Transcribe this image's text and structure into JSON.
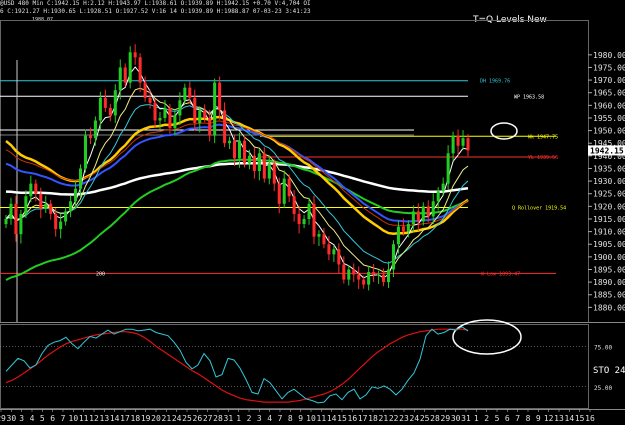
{
  "header": {
    "line1": "@USD  480 Min  C:1942.15  H:2.12  H:1943.97  L:1938.61  O:1939.89  H:1942.15  +0.70  V:4,704  OI",
    "line2": "6  C:1921.27  H:1930.65  L:1928.51  O:1927.52  V:16 14  O:1939.89  H:1988.87  07-03-23  3:41:23",
    "line3": "1988.07",
    "chart_title": "T=Q Levels New"
  },
  "chart_data": [
    {
      "type": "candlestick",
      "title": "T=Q Levels New",
      "ylim": [
        1875,
        1993
      ],
      "y_ticks": [
        "1980.00",
        "1975.00",
        "1970.00",
        "1965.00",
        "1960.00",
        "1955.00",
        "1950.00",
        "1945.00",
        "1940.00",
        "1935.00",
        "1930.00",
        "1925.00",
        "1920.00",
        "1915.00",
        "1910.00",
        "1905.00",
        "1900.00",
        "1895.00",
        "1890.00",
        "1885.00",
        "1880.00"
      ],
      "last_price_label": "1942.15",
      "x_ticks": [
        "29",
        "30",
        "3",
        "4",
        "5",
        "6",
        "7",
        "10",
        "11",
        "12",
        "13",
        "14",
        "17",
        "18",
        "19",
        "20",
        "21",
        "24",
        "25",
        "26",
        "27",
        "28",
        "31",
        "1",
        "2",
        "3",
        "4",
        "7",
        "8",
        "9",
        "10",
        "11",
        "14",
        "15",
        "16",
        "17",
        "18",
        "21",
        "22",
        "23",
        "24",
        "25",
        "28",
        "29",
        "30",
        "31",
        "1",
        "2",
        "5",
        "6",
        "7",
        "8",
        "9",
        "12",
        "13",
        "14",
        "15",
        "16"
      ],
      "levels": [
        {
          "label": "DH 1969.76",
          "value": 1969.76,
          "color": "#33c8d8"
        },
        {
          "label": "WP 1963.58",
          "value": 1963.58,
          "color": "#ffffff"
        },
        {
          "label": "Wk 1947.75",
          "value": 1947.75,
          "color": "#ffff00"
        },
        {
          "label": "YL 1939.56",
          "value": 1939.56,
          "color": "#ff3030"
        },
        {
          "label": "Q Rollover 1919.54",
          "value": 1919.54,
          "color": "#ffff00"
        },
        {
          "label": "W Low 1893.47",
          "value": 1893.47,
          "color": "#ff3030"
        },
        {
          "label": "200",
          "value": 1893.47,
          "color": "#ffffff"
        }
      ],
      "closes": [
        1915,
        1921,
        1909,
        1917,
        1924,
        1929,
        1925,
        1919,
        1921,
        1917,
        1911,
        1914,
        1918,
        1922,
        1927,
        1935,
        1948,
        1947,
        1954,
        1963,
        1959,
        1956,
        1966,
        1975,
        1969,
        1981,
        1979,
        1969,
        1963,
        1961,
        1954,
        1955,
        1959,
        1951,
        1956,
        1962,
        1967,
        1963,
        1953,
        1958,
        1955,
        1948,
        1969,
        1958,
        1945,
        1946,
        1939,
        1946,
        1937,
        1940,
        1934,
        1941,
        1931,
        1937,
        1929,
        1921,
        1931,
        1924,
        1917,
        1913,
        1915,
        1921,
        1908,
        1909,
        1905,
        1901,
        1903,
        1897,
        1891,
        1895,
        1893,
        1891,
        1889,
        1894,
        1893,
        1893,
        1890,
        1895,
        1905,
        1912,
        1910,
        1913,
        1918,
        1914,
        1920,
        1916,
        1922,
        1926,
        1929,
        1941,
        1948,
        1944,
        1947,
        1942.15
      ],
      "oscillator": {
        "label": "STO 24",
        "levels": [
          75,
          25
        ],
        "tick_labels": [
          "75.00",
          "25.00"
        ],
        "k": [
          44,
          52,
          60,
          57,
          48,
          52,
          66,
          76,
          80,
          82,
          86,
          78,
          72,
          80,
          87,
          85,
          90,
          95,
          90,
          93,
          96,
          96,
          94,
          95,
          96,
          92,
          90,
          88,
          80,
          70,
          55,
          47,
          52,
          66,
          57,
          37,
          40,
          60,
          58,
          48,
          34,
          18,
          16,
          35,
          30,
          20,
          10,
          18,
          22,
          16,
          10,
          8,
          5,
          6,
          14,
          16,
          9,
          18,
          22,
          10,
          15,
          25,
          23,
          26,
          22,
          15,
          22,
          33,
          42,
          59,
          88,
          96,
          90,
          92,
          96,
          95,
          99,
          94
        ],
        "d": [
          30,
          33,
          37,
          42,
          47,
          52,
          58,
          64,
          69,
          74,
          78,
          81,
          83,
          85,
          87,
          89,
          90,
          91,
          92,
          93,
          93,
          92,
          90,
          86,
          81,
          75,
          70,
          65,
          60,
          55,
          50,
          45,
          41,
          36,
          31,
          26,
          21,
          17,
          14,
          11,
          9,
          8,
          7,
          6,
          6,
          6,
          6,
          6,
          7,
          8,
          10,
          12,
          14,
          16,
          19,
          23,
          28,
          34,
          41,
          48,
          55,
          62,
          68,
          73,
          78,
          82,
          86,
          89,
          91,
          93,
          94,
          95,
          96,
          96,
          96,
          96,
          96,
          95
        ]
      }
    }
  ]
}
